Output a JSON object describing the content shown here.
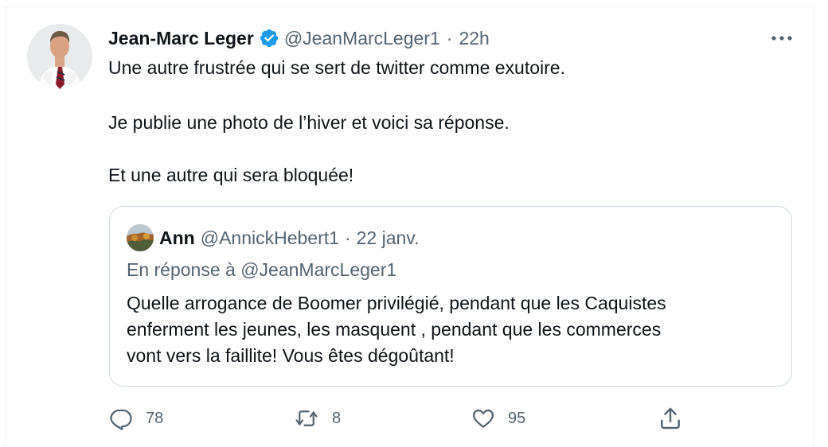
{
  "tweet": {
    "author": {
      "name": "Jean-Marc Leger",
      "handle": "@JeanMarcLeger1",
      "verified": true
    },
    "separator": "·",
    "time": "22h",
    "lines": [
      "Une autre frustrée qui se sert de twitter comme exutoire.",
      "Je publie une photo de l’hiver et voici sa réponse.",
      "Et une autre qui sera bloquée!"
    ],
    "quoted": {
      "name": "Ann",
      "handle": "@AnnickHebert1",
      "separator": "·",
      "date": "22 janv.",
      "reply_to": "En réponse à @JeanMarcLeger1",
      "lines": [
        "Quelle arrogance de Boomer privilégié, pendant que les Caquistes",
        "enferment les jeunes, les masquent , pendant que les commerces",
        "vont vers la faillite! Vous êtes dégoûtant!"
      ]
    },
    "actions": {
      "replies": "78",
      "retweets": "8",
      "likes": "95"
    }
  },
  "icons": {
    "verified": "verified-badge-icon",
    "more": "more-options-icon",
    "reply": "reply-icon",
    "retweet": "retweet-icon",
    "like": "like-icon",
    "share": "share-icon"
  },
  "colors": {
    "text": "#0f1419",
    "secondary": "#536471",
    "verified_blue": "#1d9bf0",
    "border": "#cfd9de"
  }
}
